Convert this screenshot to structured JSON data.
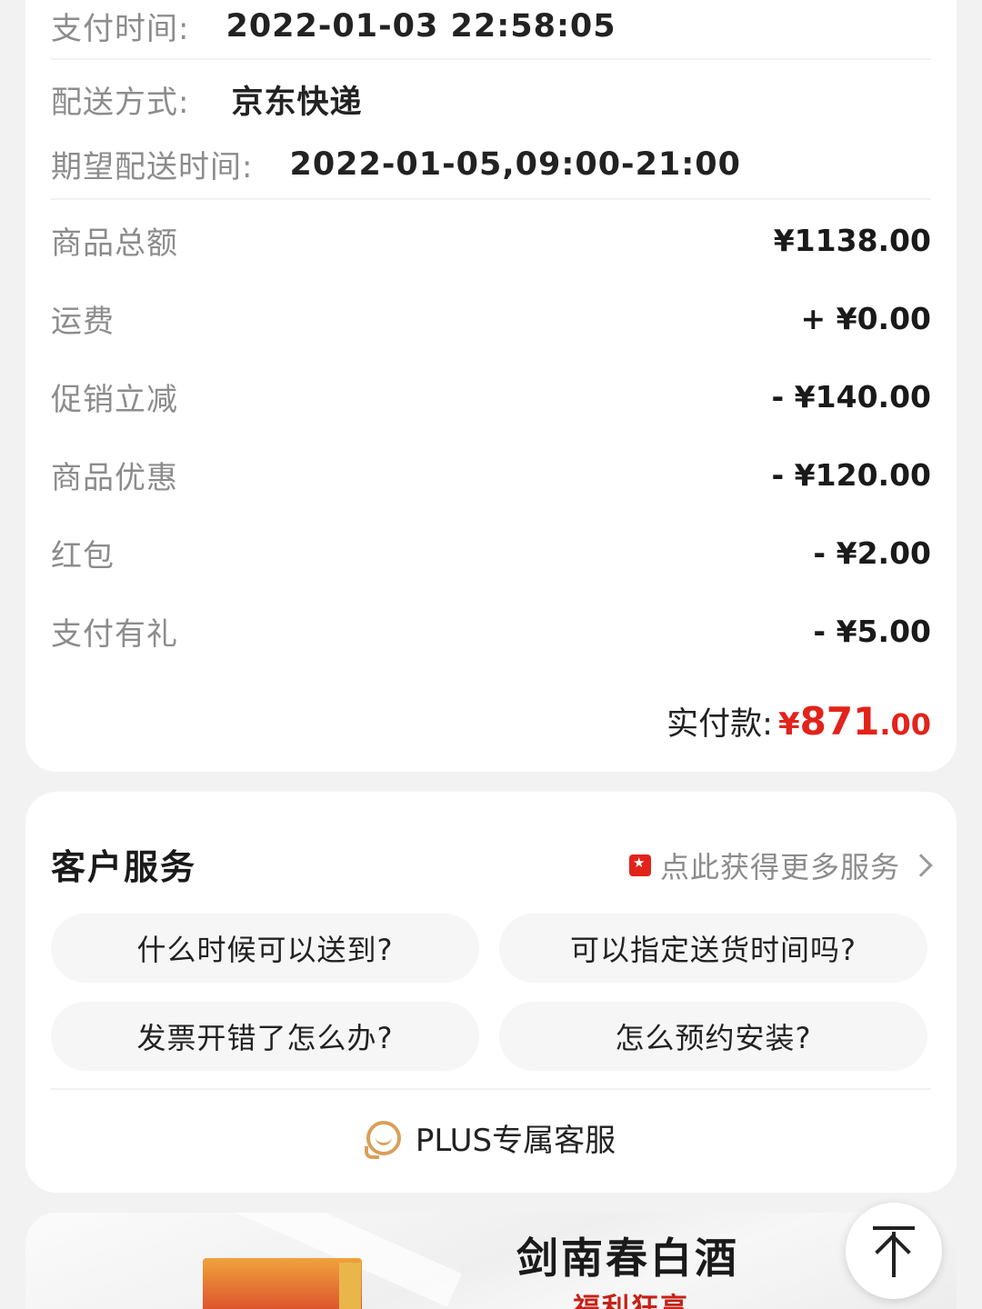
{
  "order_info": {
    "pay_time_label": "支付时间:",
    "pay_time_value": "2022-01-03 22:58:05",
    "delivery_label": "配送方式:",
    "delivery_value": "京东快递",
    "expected_label": "期望配送时间:",
    "expected_value": "2022-01-05,09:00-21:00"
  },
  "amounts": [
    {
      "label": "商品总额",
      "value": "¥1138.00"
    },
    {
      "label": "运费",
      "value": "+ ¥0.00"
    },
    {
      "label": "促销立减",
      "value": "- ¥140.00"
    },
    {
      "label": "商品优惠",
      "value": "- ¥120.00"
    },
    {
      "label": "红包",
      "value": "- ¥2.00"
    },
    {
      "label": "支付有礼",
      "value": "- ¥5.00"
    }
  ],
  "paid": {
    "label": "实付款:",
    "currency": "¥",
    "integer": "871",
    "decimal": ".00",
    "color": "#e2231a"
  },
  "service": {
    "title": "客户服务",
    "more_text": "点此获得更多服务",
    "questions": [
      "什么时候可以送到?",
      "可以指定送货时间吗?",
      "发票开错了怎么办?",
      "怎么预约安装?"
    ],
    "plus_label": "PLUS专属客服"
  },
  "ad": {
    "title": "剑南春白酒",
    "subtitle": "福利狂享"
  },
  "icons": {
    "more_badge": "star-badge-icon",
    "chevron": "chevron-right-icon",
    "plus": "chat-bubble-icon",
    "top": "back-to-top-icon"
  }
}
